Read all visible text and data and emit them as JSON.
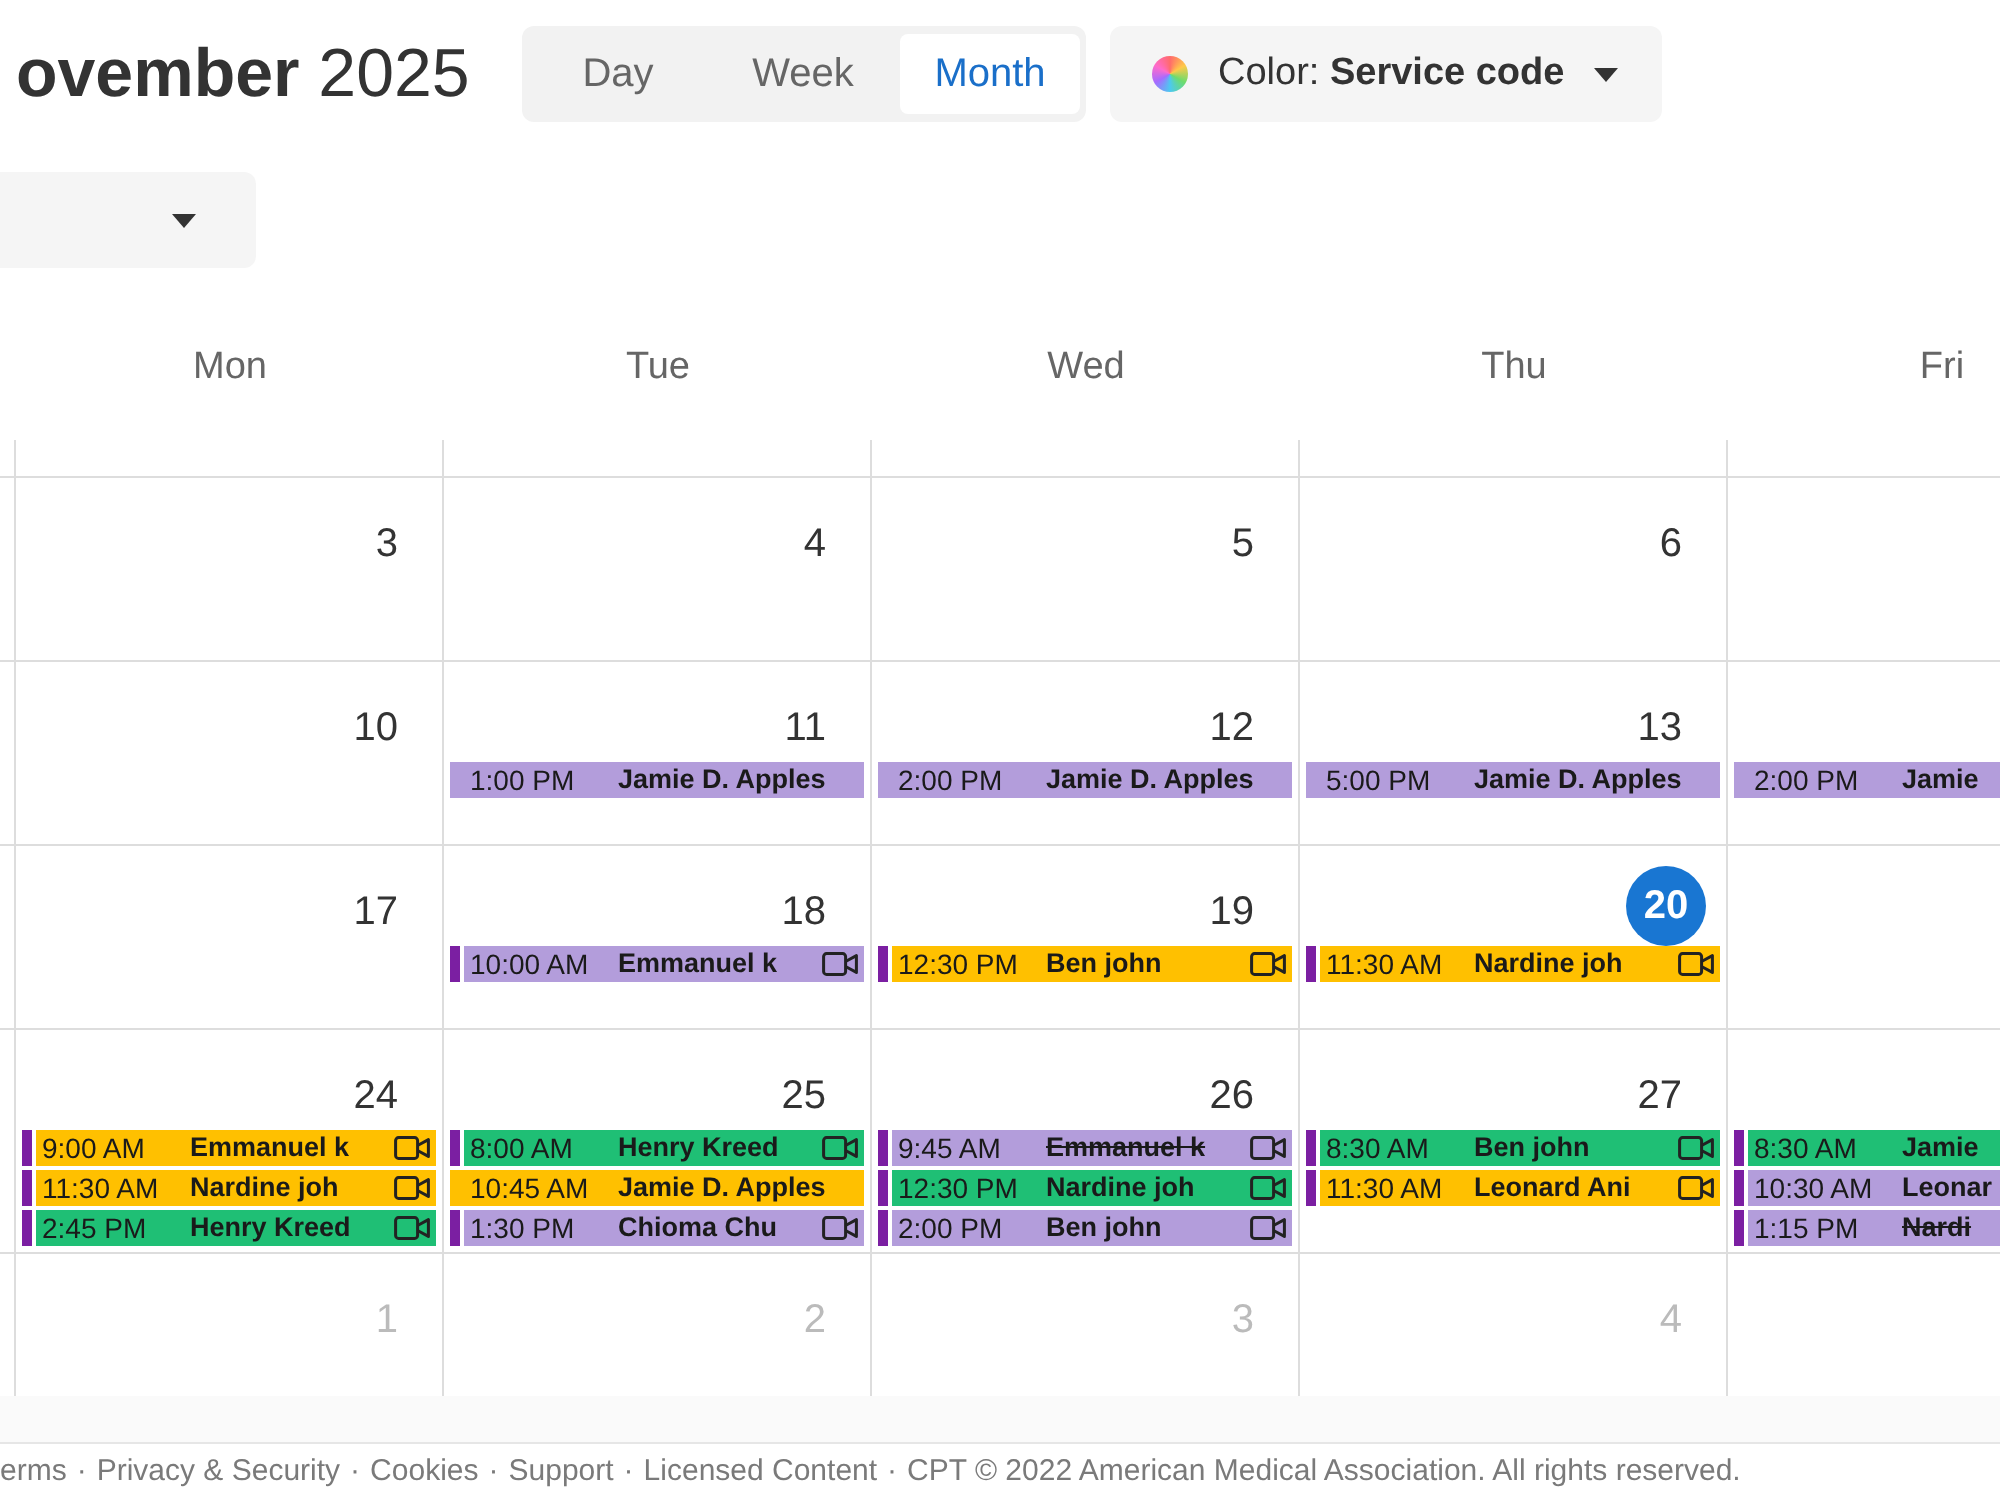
{
  "header": {
    "title": "**ovember** 2025",
    "views": [
      {
        "label": "Day",
        "selected": false
      },
      {
        "label": "Week",
        "selected": false
      },
      {
        "label": "Month",
        "selected": true
      }
    ],
    "color_by": "Color: **Service code**"
  },
  "calendar": {
    "weekdays": [
      "Mon",
      "Tue",
      "Wed",
      "Thu",
      "Fri"
    ],
    "weeks": [
      {
        "days": [
          {
            "date": "3",
            "outside": false,
            "today": false
          },
          {
            "date": "4",
            "outside": false,
            "today": false
          },
          {
            "date": "5",
            "outside": false,
            "today": false
          },
          {
            "date": "6",
            "outside": false,
            "today": false
          }
        ]
      },
      {
        "days": [
          {
            "date": "10",
            "outside": false,
            "today": false
          },
          {
            "date": "11",
            "outside": false,
            "today": false,
            "events": [
              {
                "time": "1:00 PM",
                "name": "Jamie D. Apples",
                "color": "#b39ddb",
                "flag": false,
                "video": false,
                "cancelled": false
              }
            ]
          },
          {
            "date": "12",
            "outside": false,
            "today": false,
            "events": [
              {
                "time": "2:00 PM",
                "name": "Jamie D. Apples",
                "color": "#b39ddb",
                "flag": false,
                "video": false,
                "cancelled": false
              }
            ]
          },
          {
            "date": "13",
            "outside": false,
            "today": false,
            "events": [
              {
                "time": "5:00 PM",
                "name": "Jamie D. Apples",
                "color": "#b39ddb",
                "flag": false,
                "video": false,
                "cancelled": false
              }
            ]
          },
          {
            "events": [
              {
                "time": "2:00 PM",
                "name": "Jamie",
                "color": "#b39ddb",
                "flag": false,
                "video": false,
                "cancelled": false
              }
            ]
          }
        ]
      },
      {
        "days": [
          {
            "date": "17",
            "outside": false,
            "today": false
          },
          {
            "date": "18",
            "outside": false,
            "today": false,
            "events": [
              {
                "time": "10:00 AM",
                "name": "Emmanuel k",
                "color": "#b39ddb",
                "flag": true,
                "video": true,
                "cancelled": false
              }
            ]
          },
          {
            "date": "19",
            "outside": false,
            "today": false,
            "events": [
              {
                "time": "12:30 PM",
                "name": "Ben john",
                "color": "#ffc000",
                "flag": true,
                "video": true,
                "cancelled": false
              }
            ]
          },
          {
            "date": "20",
            "outside": false,
            "today": true,
            "events": [
              {
                "time": "11:30 AM",
                "name": "Nardine joh",
                "color": "#ffc000",
                "flag": true,
                "video": true,
                "cancelled": false
              }
            ]
          }
        ]
      },
      {
        "days": [
          {
            "date": "24",
            "outside": false,
            "today": false,
            "events": [
              {
                "time": "9:00 AM",
                "name": "Emmanuel k",
                "color": "#ffc000",
                "flag": true,
                "video": true,
                "cancelled": false
              },
              {
                "time": "11:30 AM",
                "name": "Nardine joh",
                "color": "#ffc000",
                "flag": true,
                "video": true,
                "cancelled": false
              },
              {
                "time": "2:45 PM",
                "name": "Henry Kreed",
                "color": "#1fbf75",
                "flag": true,
                "video": true,
                "cancelled": false
              }
            ]
          },
          {
            "date": "25",
            "outside": false,
            "today": false,
            "events": [
              {
                "time": "8:00 AM",
                "name": "Henry Kreed",
                "color": "#1fbf75",
                "flag": true,
                "video": true,
                "cancelled": false
              },
              {
                "time": "10:45 AM",
                "name": "Jamie D. Apples",
                "color": "#ffc000",
                "flag": false,
                "video": false,
                "cancelled": false
              },
              {
                "time": "1:30 PM",
                "name": "Chioma Chu",
                "color": "#b39ddb",
                "flag": true,
                "video": true,
                "cancelled": false
              }
            ]
          },
          {
            "date": "26",
            "outside": false,
            "today": false,
            "events": [
              {
                "time": "9:45 AM",
                "name": "Emmanuel k",
                "color": "#b39ddb",
                "flag": true,
                "video": true,
                "cancelled": true
              },
              {
                "time": "12:30 PM",
                "name": "Nardine joh",
                "color": "#1fbf75",
                "flag": true,
                "video": true,
                "cancelled": false
              },
              {
                "time": "2:00 PM",
                "name": "Ben john",
                "color": "#b39ddb",
                "flag": true,
                "video": true,
                "cancelled": false
              }
            ]
          },
          {
            "date": "27",
            "outside": false,
            "today": false,
            "events": [
              {
                "time": "8:30 AM",
                "name": "Ben john",
                "color": "#1fbf75",
                "flag": true,
                "video": true,
                "cancelled": false
              },
              {
                "time": "11:30 AM",
                "name": "Leonard Ani",
                "color": "#ffc000",
                "flag": true,
                "video": true,
                "cancelled": false
              }
            ]
          },
          {
            "events": [
              {
                "time": "8:30 AM",
                "name": "Jamie",
                "color": "#1fbf75",
                "flag": true,
                "video": false,
                "cancelled": false
              },
              {
                "time": "10:30 AM",
                "name": "Leonar",
                "color": "#b39ddb",
                "flag": true,
                "video": false,
                "cancelled": false
              },
              {
                "time": "1:15 PM",
                "name": "Nardi",
                "color": "#b39ddb",
                "flag": true,
                "video": false,
                "cancelled": true
              }
            ]
          }
        ]
      },
      {
        "days": [
          {
            "date": "1",
            "outside": true,
            "today": false
          },
          {
            "date": "2",
            "outside": true,
            "today": false
          },
          {
            "date": "3",
            "outside": true,
            "today": false
          },
          {
            "date": "4",
            "outside": true,
            "today": false
          }
        ]
      }
    ]
  },
  "footer": [
    {
      "kind": "link",
      "text": "erms"
    },
    {
      "kind": "separator",
      "text": "·"
    },
    {
      "kind": "link",
      "text": "Privacy & Security"
    },
    {
      "kind": "separator",
      "text": "·"
    },
    {
      "kind": "link",
      "text": "Cookies"
    },
    {
      "kind": "separator",
      "text": "·"
    },
    {
      "kind": "link",
      "text": "Support"
    },
    {
      "kind": "separator",
      "text": "·"
    },
    {
      "kind": "link",
      "text": "Licensed Content"
    },
    {
      "kind": "separator",
      "text": "·"
    },
    {
      "kind": "text",
      "text": "CPT © 2022 American Medical Association. All rights reserved."
    }
  ]
}
